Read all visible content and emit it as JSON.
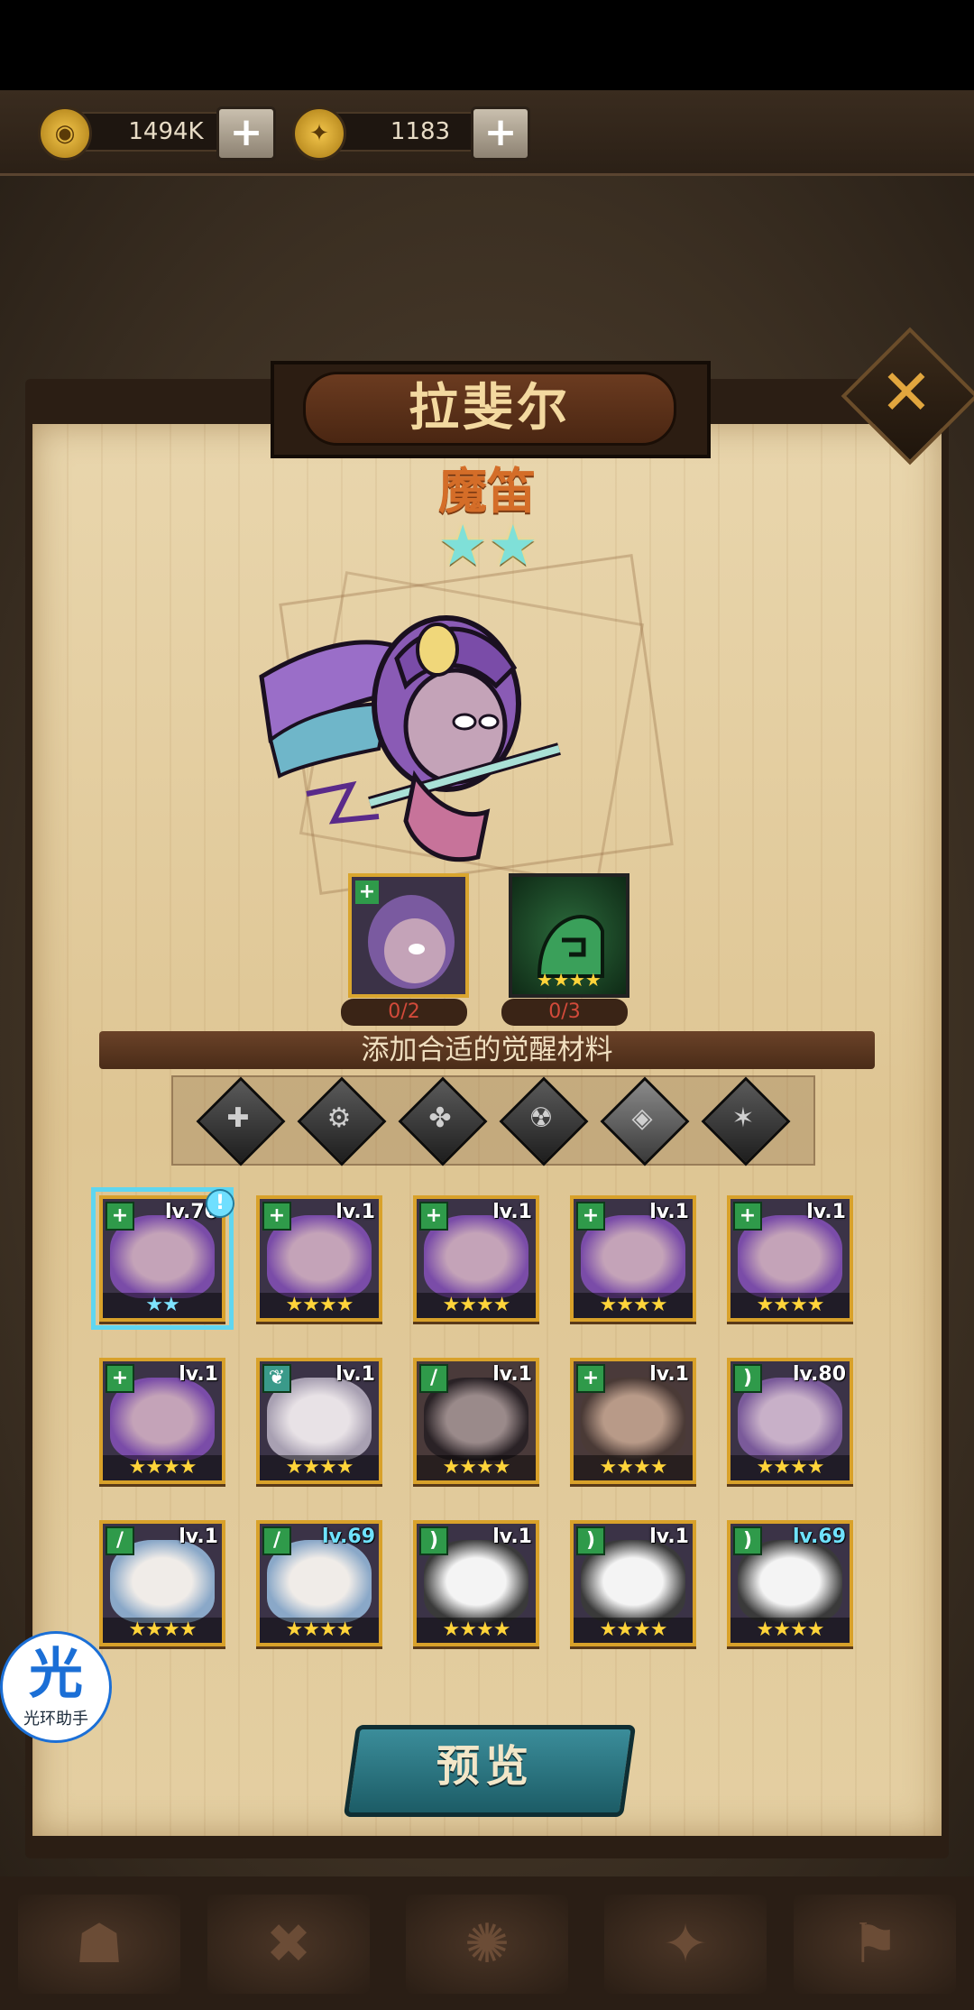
{
  "currencies": {
    "gold": {
      "icon": "gold-coin-icon",
      "value": "1494K"
    },
    "gem": {
      "icon": "gem-coin-icon",
      "value": "1183"
    }
  },
  "hero": {
    "name": "拉斐尔",
    "title": "魔笛",
    "stars": 2
  },
  "materials": [
    {
      "count": "0/2"
    },
    {
      "count": "0/3"
    }
  ],
  "hint": "添加合适的觉醒材料",
  "filters": [
    "faction-1-icon",
    "faction-2-icon",
    "faction-3-icon",
    "faction-4-icon",
    "faction-5-icon",
    "faction-6-icon"
  ],
  "cards": [
    {
      "level": "lv.70",
      "stars": "★★",
      "selected": true
    },
    {
      "level": "lv.1",
      "stars": "★★★★"
    },
    {
      "level": "lv.1",
      "stars": "★★★★"
    },
    {
      "level": "lv.1",
      "stars": "★★★★"
    },
    {
      "level": "lv.1",
      "stars": "★★★★"
    },
    {
      "level": "lv.1",
      "stars": "★★★★"
    },
    {
      "level": "lv.1",
      "stars": "★★★★"
    },
    {
      "level": "lv.1",
      "stars": "★★★★"
    },
    {
      "level": "lv.1",
      "stars": "★★★★"
    },
    {
      "level": "lv.80",
      "stars": "★★★★"
    },
    {
      "level": "lv.1",
      "stars": "★★★★"
    },
    {
      "level": "lv.69",
      "stars": "★★★★"
    },
    {
      "level": "lv.1",
      "stars": "★★★★"
    },
    {
      "level": "lv.1",
      "stars": "★★★★"
    },
    {
      "level": "lv.69",
      "stars": "★★★★"
    }
  ],
  "preview_label": "预览",
  "assistant": {
    "glyph": "光",
    "label": "光环助手"
  },
  "colors": {
    "accent": "#d8a12a",
    "teal": "#2d7c88",
    "selected": "#5fd6f0"
  }
}
